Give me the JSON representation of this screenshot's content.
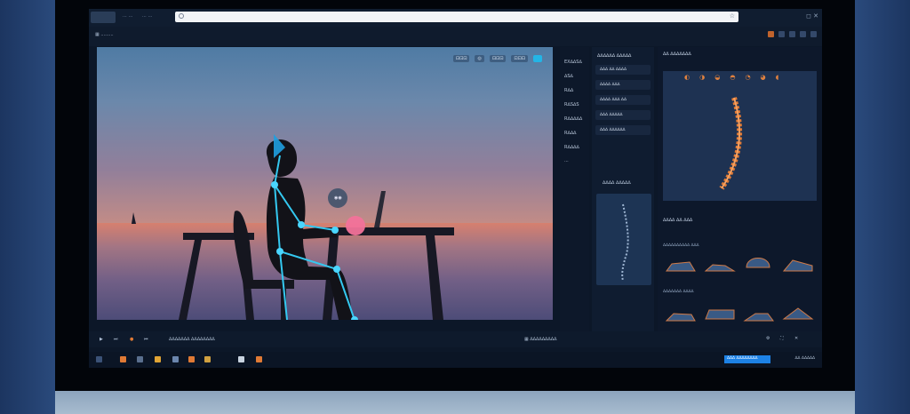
{
  "browser": {
    "tab_label": "...",
    "nav_hint": "⋯ ⋯",
    "url": "",
    "window_controls": "◻ ✕"
  },
  "subbar": {
    "title": "▦ ......... ",
    "tool_icons": [
      "folder-icon",
      "settings-icon",
      "copy-icon",
      "share-icon",
      "close-icon"
    ]
  },
  "video": {
    "controls": [
      "⊡⊡⊡",
      "⊡⊡⊡",
      "◎",
      "⊡⊡⊡",
      "⊡⊡⊡"
    ],
    "cursor_hint": "◉◉"
  },
  "list": {
    "items": [
      "EX∆∆S∆",
      "∆S∆",
      "R∆∆",
      "R∆S∆S",
      "R∆∆∆∆∆",
      "R∆∆∆",
      "R∆∆∆∆",
      "⋯"
    ]
  },
  "mid": {
    "header": "∆∆∆∆∆∆ ∆∆∆∆∆",
    "rows": [
      "∆∆∆ ∆∆ ∆∆∆∆",
      "∆∆∆∆ ∆∆∆",
      "∆∆∆∆ ∆∆∆ ∆∆",
      "∆∆∆ ∆∆∆∆∆",
      "∆∆∆ ∆∆∆∆∆∆"
    ],
    "subheader": "∆∆∆∆ ∆∆∆∆∆"
  },
  "right": {
    "header": "∆∆ ∆∆∆∆∆∆∆",
    "icons": [
      "◐",
      "◑",
      "◒",
      "◓",
      "◔",
      "◕",
      "◖"
    ],
    "section2": "∆∆∆∆ ∆∆ ∆∆∆",
    "section3": "∆∆∆∆∆∆∆∆∆∆ ∆∆∆",
    "section4": "∆∆∆∆∆∆∆ ∆∆∆∆"
  },
  "controls": {
    "left_label": "∆∆∆∆∆∆∆ ∆∆∆∆∆∆∆∆",
    "center_label": "▦ ∆∆∆∆∆∆∆∆∆",
    "right_icons": [
      "settings-icon",
      "fullscreen-icon",
      "close-icon"
    ]
  },
  "taskbar": {
    "badge_label": "∆∆∆ ∆∆∆∆∆∆∆∆",
    "time": "∆∆ ∆∆∆∆∆"
  },
  "colors": {
    "accent": "#23b5e6",
    "spine": "#e07a35",
    "badge": "#1d82e6"
  }
}
